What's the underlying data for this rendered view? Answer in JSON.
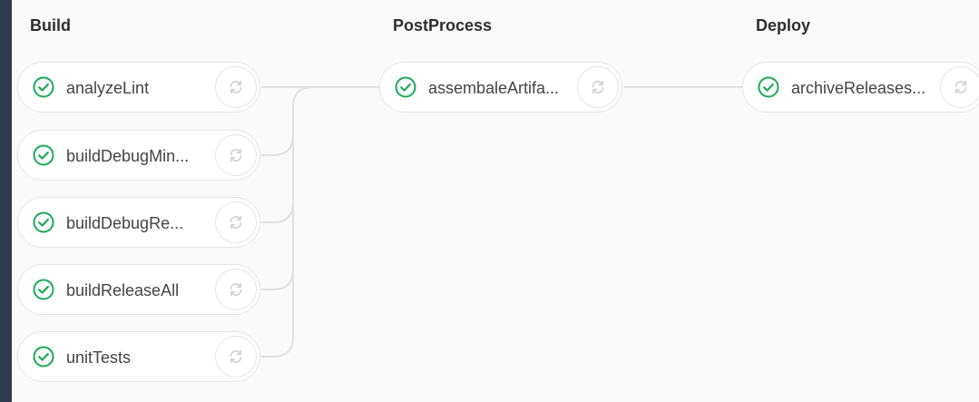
{
  "stages": [
    {
      "title": "Build"
    },
    {
      "title": "PostProcess"
    },
    {
      "title": "Deploy"
    }
  ],
  "jobs": [
    {
      "name": "analyzeLint",
      "status": "success",
      "status_icon": "check-circle-icon",
      "action_icon": "retry-icon"
    },
    {
      "name": "buildDebugMin...",
      "status": "success",
      "status_icon": "check-circle-icon",
      "action_icon": "retry-icon"
    },
    {
      "name": "buildDebugRe...",
      "status": "success",
      "status_icon": "check-circle-icon",
      "action_icon": "retry-icon"
    },
    {
      "name": "buildReleaseAll",
      "status": "success",
      "status_icon": "check-circle-icon",
      "action_icon": "retry-icon"
    },
    {
      "name": "unitTests",
      "status": "success",
      "status_icon": "check-circle-icon",
      "action_icon": "retry-icon"
    },
    {
      "name": "assembaleArtifa...",
      "status": "success",
      "status_icon": "check-circle-icon",
      "action_icon": "retry-icon"
    },
    {
      "name": "archiveReleases...",
      "status": "success",
      "status_icon": "check-circle-icon",
      "action_icon": "retry-icon"
    }
  ],
  "colors": {
    "success": "#1aaa55",
    "connector": "#e1e1e1",
    "frame": "#2e3e4d",
    "canvas": "#fafafa"
  }
}
